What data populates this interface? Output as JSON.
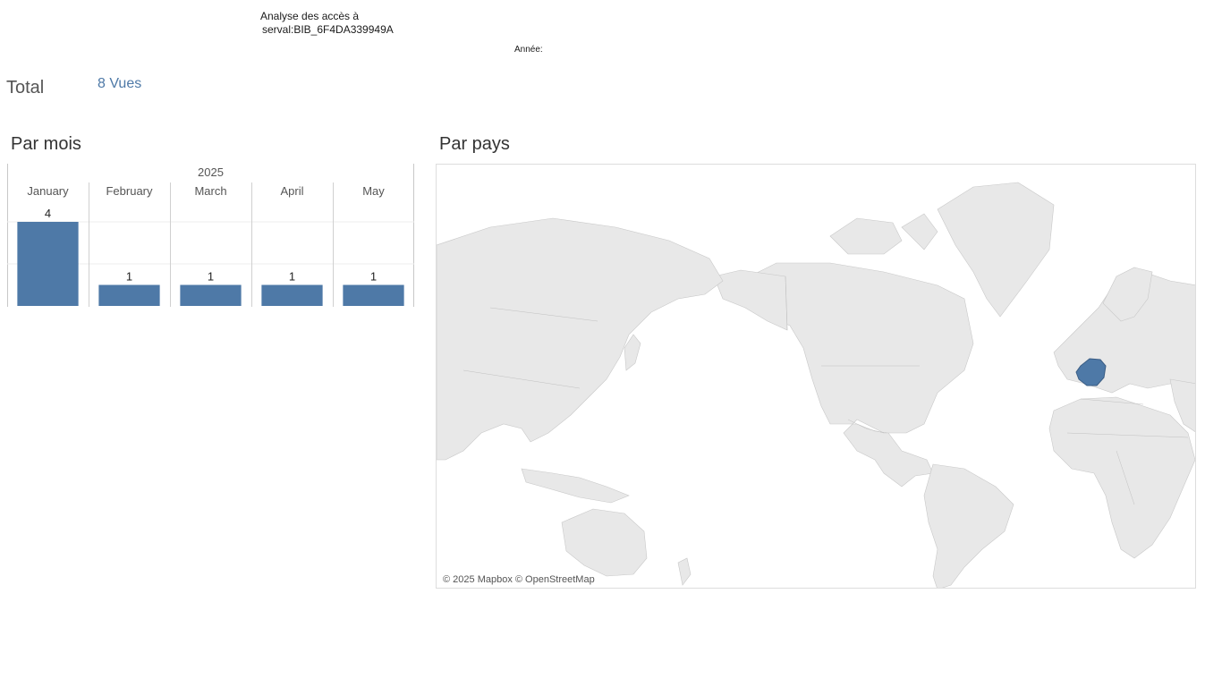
{
  "header": {
    "title_line1": "Analyse des accès à",
    "title_line2": "serval:BIB_6F4DA339949A",
    "year_filter_label": "Année:"
  },
  "total": {
    "label": "Total",
    "value": "8 Vues"
  },
  "months_section": {
    "title": "Par mois"
  },
  "countries_section": {
    "title": "Par pays",
    "attribution": "© 2025 Mapbox © OpenStreetMap",
    "highlighted_country": "France",
    "highlight_color": "#4e79a7",
    "land_color": "#e8e8e8"
  },
  "chart_data": {
    "type": "bar",
    "year": "2025",
    "categories": [
      "January",
      "February",
      "March",
      "April",
      "May"
    ],
    "values": [
      4,
      1,
      1,
      1,
      1
    ],
    "ylim": [
      0,
      4
    ],
    "bar_color": "#4e79a7",
    "grid": true
  }
}
